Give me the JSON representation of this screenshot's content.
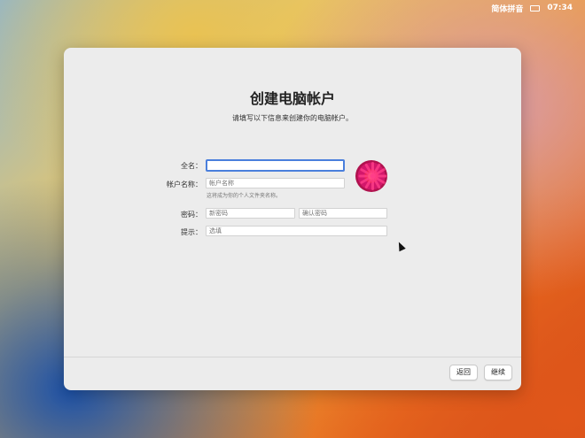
{
  "menubar": {
    "input_method": "简体拼音",
    "keyboard_icon": "keyboard-icon",
    "time": "07:34"
  },
  "window": {
    "title": "创建电脑帐户",
    "subtitle": "请填写以下信息来创建你的电脑帐户。",
    "form": {
      "full_name_label": "全名：",
      "full_name_value": "",
      "account_name_label": "帐户名称：",
      "account_name_placeholder": "帐户名称",
      "account_name_hint": "这将成为你的个人文件夹名称。",
      "password_label": "密码：",
      "password_placeholder": "新密码",
      "verify_placeholder": "确认密码",
      "hint_label": "提示：",
      "hint_placeholder": "选填"
    },
    "buttons": {
      "back": "返回",
      "continue": "继续"
    }
  }
}
